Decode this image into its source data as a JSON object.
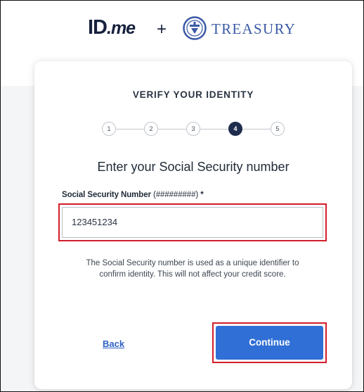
{
  "header": {
    "logo_primary": "ID",
    "logo_secondary": ".me",
    "separator": "+",
    "partner_name": "TREASURY",
    "seal_icon": "treasury-seal-icon"
  },
  "card": {
    "title": "VERIFY YOUR IDENTITY",
    "steps": [
      {
        "label": "1",
        "state": "inactive"
      },
      {
        "label": "2",
        "state": "inactive"
      },
      {
        "label": "3",
        "state": "inactive"
      },
      {
        "label": "4",
        "state": "active"
      },
      {
        "label": "5",
        "state": "inactive"
      }
    ],
    "current_step": 4,
    "heading": "Enter your Social Security number",
    "field_label_main": "Social Security Number ",
    "field_label_format": "(#########)",
    "field_label_required": " *",
    "ssn_value": "123451234",
    "help_text": "The Social Security number is used as a unique identifier to confirm identity. This will not affect your credit score.",
    "back_label": "Back",
    "continue_label": "Continue"
  },
  "colors": {
    "primary_button": "#2f6fd6",
    "highlight_border": "#d21e2b",
    "link": "#2d5fc4",
    "active_step": "#1f2d4d"
  }
}
